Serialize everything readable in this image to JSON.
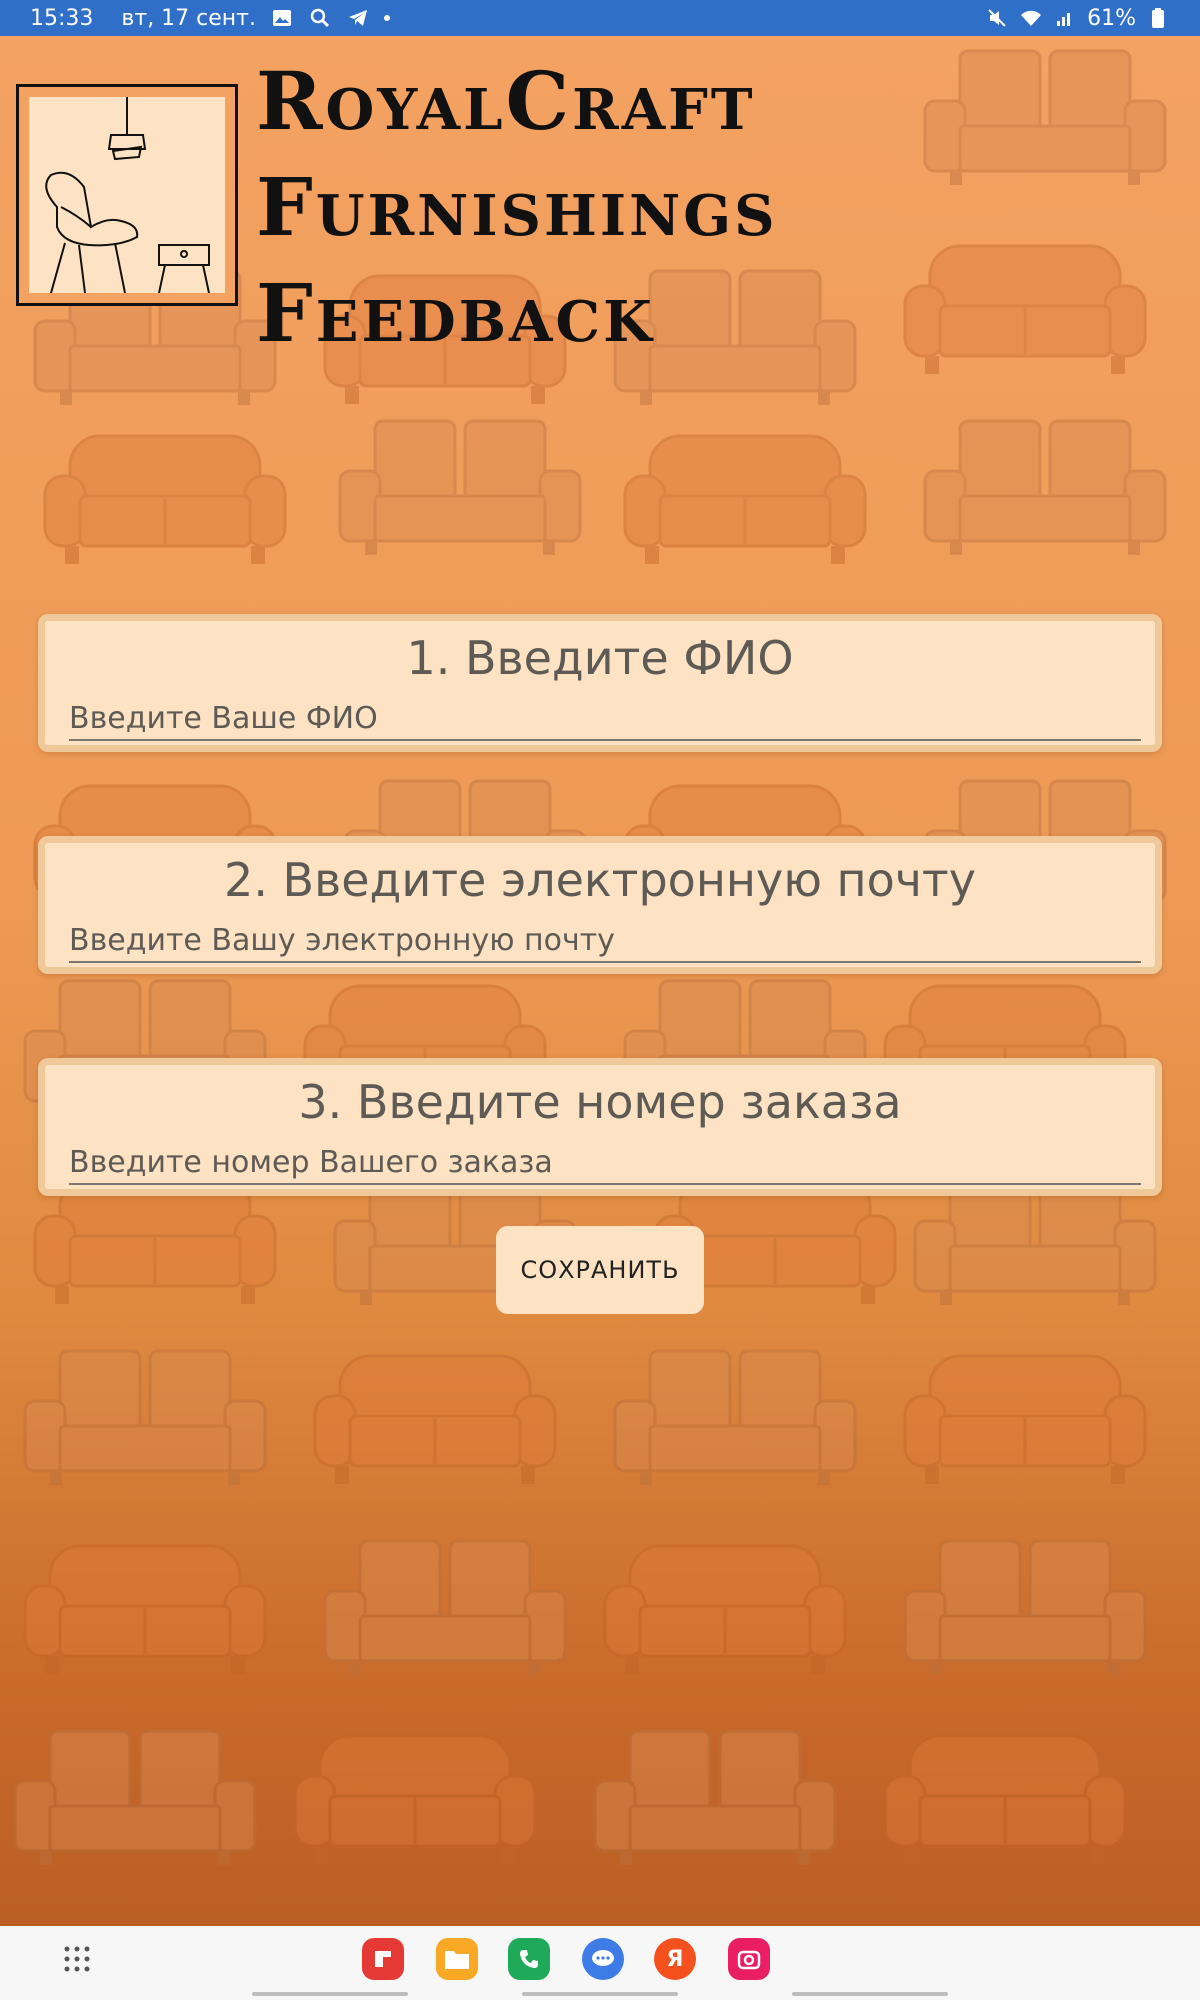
{
  "status_bar": {
    "time": "15:33",
    "date": "вт, 17 сент.",
    "battery": "61%",
    "icons": [
      "gallery-icon",
      "search-icon",
      "telegram-icon",
      "mute-icon",
      "wifi-icon",
      "signal-icon",
      "battery-icon"
    ]
  },
  "header": {
    "title_line1": "RoyalCraft",
    "title_line2": "Furnishings",
    "title_line3": "Feedback",
    "logo": "chair-lamp-logo"
  },
  "form": {
    "fields": [
      {
        "title": "1. Введите ФИО",
        "placeholder": "Введите Ваше ФИО",
        "value": ""
      },
      {
        "title": "2. Введите электронную почту",
        "placeholder": "Введите Вашу электронную почту",
        "value": ""
      },
      {
        "title": "3. Введите номер заказа",
        "placeholder": "Введите номер Вашего заказа",
        "value": ""
      }
    ],
    "save_label": "СОХРАНИТЬ"
  },
  "dock": {
    "apps": [
      {
        "name": "flipboard-app",
        "color": "#e53935"
      },
      {
        "name": "files-app",
        "color": "#f9a825"
      },
      {
        "name": "phone-app",
        "color": "#1faa59"
      },
      {
        "name": "messages-app",
        "color": "#3d7be6"
      },
      {
        "name": "yandex-app",
        "color": "#f4511e",
        "letter": "Я"
      },
      {
        "name": "camera-app",
        "color": "#e91e63"
      }
    ]
  },
  "colors": {
    "status_bar": "#2f6fc8",
    "card_bg": "#fde3c4",
    "card_border": "#f0c99a",
    "accent_orange": "#f4a262"
  }
}
